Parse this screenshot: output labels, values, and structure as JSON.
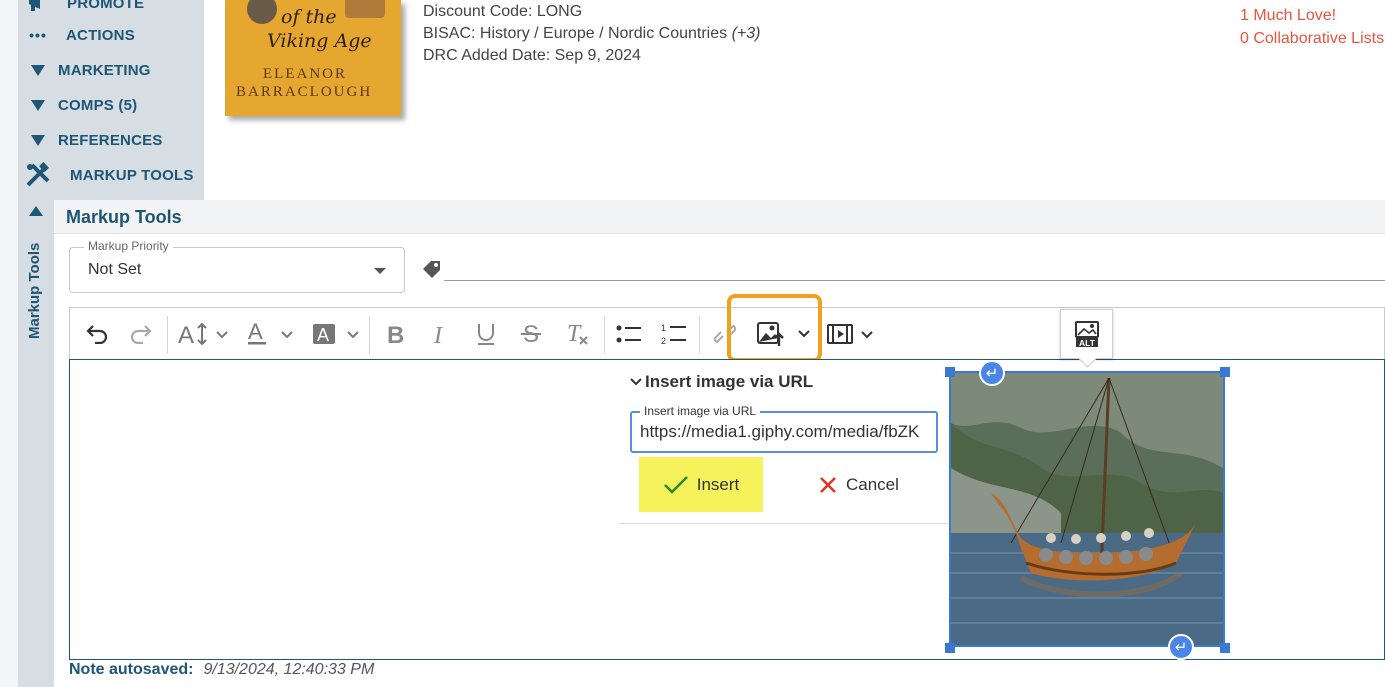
{
  "sidebar": {
    "items": [
      {
        "label": "PROMOTE",
        "icon": "megaphone-icon"
      },
      {
        "label": "ACTIONS",
        "icon": "more-dots-icon"
      },
      {
        "label": "MARKETING",
        "icon": "triangle-down-icon"
      },
      {
        "label": "COMPS (5)",
        "icon": "triangle-down-icon"
      },
      {
        "label": "REFERENCES",
        "icon": "triangle-down-icon"
      },
      {
        "label": "MARKUP TOOLS",
        "icon": "tools-icon"
      }
    ],
    "vertical_label": "Markup Tools"
  },
  "book": {
    "title_line1": "of the",
    "title_line2": "Viking Age",
    "author_line1": "ELEANOR",
    "author_line2": "BARRACLOUGH"
  },
  "meta": {
    "discount": "Discount Code: LONG",
    "bisac": "BISAC: History / Europe / Nordic Countries",
    "bisac_more": "(+3)",
    "drc_added": "DRC Added Date: Sep 9, 2024"
  },
  "links": {
    "love": "1 Much Love!",
    "collab": "0 Collaborative Lists"
  },
  "markup_tools": {
    "title": "Markup Tools",
    "priority_label": "Markup Priority",
    "priority_value": "Not Set"
  },
  "toolbar": {
    "buttons": [
      "undo-icon",
      "redo-icon",
      "font-size-icon",
      "font-color-icon",
      "highlight-icon",
      "bold-icon",
      "italic-icon",
      "underline-icon",
      "strikethrough-icon",
      "clear-format-icon",
      "bullet-list-icon",
      "numbered-list-icon",
      "link-icon",
      "insert-image-icon",
      "insert-video-icon"
    ]
  },
  "popup": {
    "title": "Insert image via URL",
    "field_label": "Insert image via URL",
    "field_value": "https://media1.giphy.com/media/fbZK",
    "insert_label": "Insert",
    "cancel_label": "Cancel"
  },
  "alt_button": {
    "label": "ALT"
  },
  "footer": {
    "autosave_label": "Note autosaved:",
    "autosave_time": "9/13/2024, 12:40:33 PM"
  },
  "colors": {
    "brand": "#1f5575",
    "link_red": "#e8553f",
    "highlight_orange": "#f0a21d",
    "insert_yellow": "#f6f25b",
    "selection_blue": "#3a78d6"
  }
}
